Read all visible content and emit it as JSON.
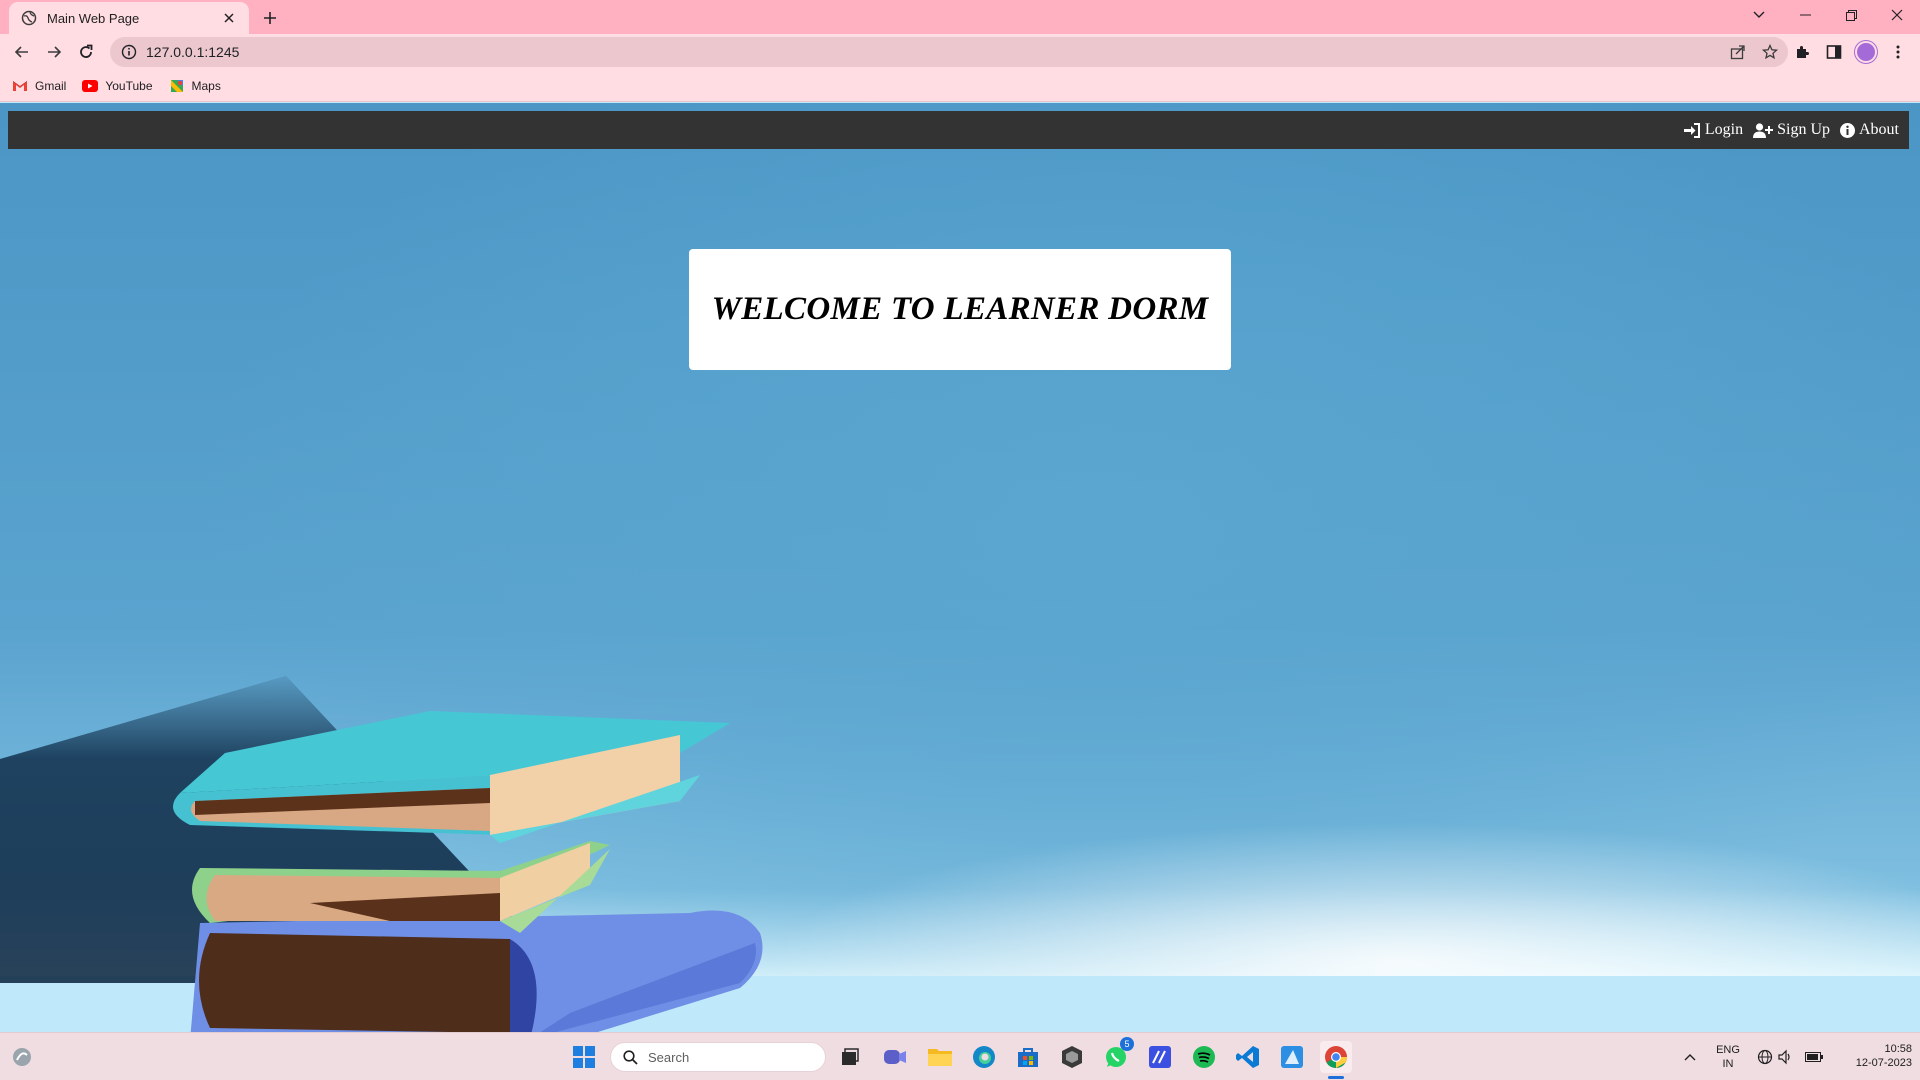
{
  "browser": {
    "tab_title": "Main Web Page",
    "url": "127.0.0.1:1245",
    "bookmarks": [
      {
        "label": "Gmail",
        "icon": "gmail-icon"
      },
      {
        "label": "YouTube",
        "icon": "youtube-icon"
      },
      {
        "label": "Maps",
        "icon": "maps-icon"
      }
    ]
  },
  "nav": {
    "login": "Login",
    "signup": "Sign Up",
    "about": "About"
  },
  "hero": {
    "welcome": "WELCOME TO LEARNER DORM"
  },
  "taskbar": {
    "search_label": "Search",
    "whatsapp_badge": "5",
    "lang_top": "ENG",
    "lang_bottom": "IN",
    "time": "10:58",
    "date": "12-07-2023"
  },
  "colors": {
    "navbar": "#333333",
    "tab_bar": "#ffb1c1",
    "toolbar": "#ffdde3",
    "hero_blue": "#4b96c5"
  }
}
